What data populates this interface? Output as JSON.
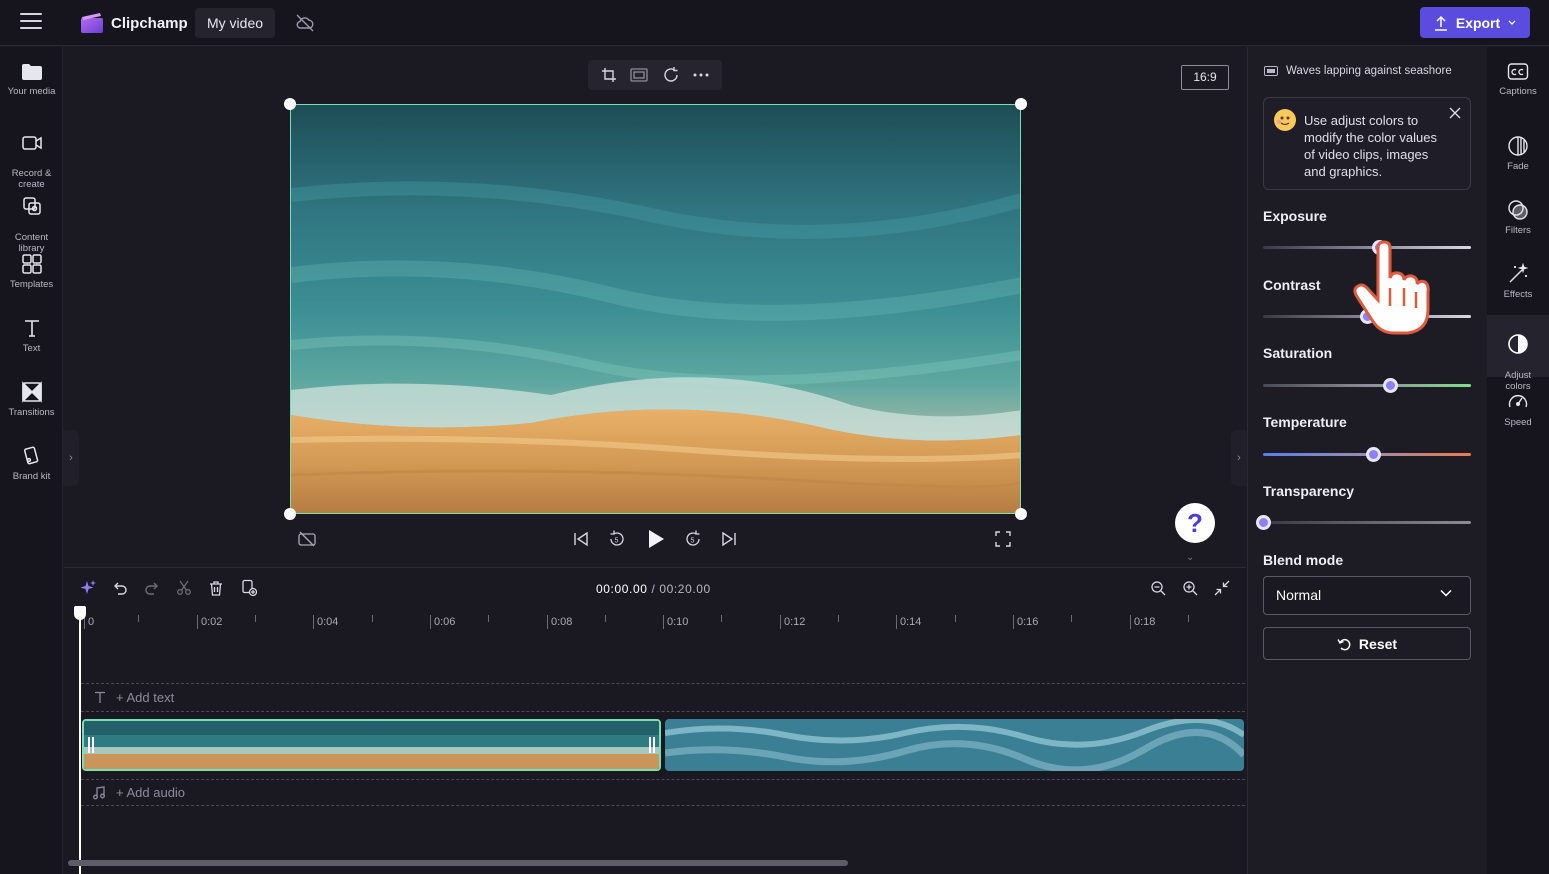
{
  "app": {
    "brand": "Clipchamp",
    "project_name": "My video",
    "export_label": "Export"
  },
  "left_rail": [
    {
      "id": "your-media",
      "label": "Your media"
    },
    {
      "id": "record-create",
      "label": "Record &\ncreate"
    },
    {
      "id": "content-library",
      "label": "Content\nlibrary"
    },
    {
      "id": "templates",
      "label": "Templates"
    },
    {
      "id": "text",
      "label": "Text"
    },
    {
      "id": "transitions",
      "label": "Transitions"
    },
    {
      "id": "brand-kit",
      "label": "Brand kit"
    }
  ],
  "preview": {
    "aspect_ratio": "16:9"
  },
  "timeline": {
    "current_time": "00:00.00",
    "duration": "/ 00:20.00",
    "ticks": [
      "0",
      "0:02",
      "0:04",
      "0:06",
      "0:08",
      "0:10",
      "0:12",
      "0:14",
      "0:16",
      "0:18"
    ],
    "add_text": "+ Add text",
    "add_audio": "+ Add audio"
  },
  "panel": {
    "clip_name": "Waves lapping against seashore",
    "tip": "Use adjust colors to modify the color values of video clips, images and graphics.",
    "exposure_label": "Exposure",
    "contrast_label": "Contrast",
    "saturation_label": "Saturation",
    "temperature_label": "Temperature",
    "transparency_label": "Transparency",
    "blend_mode_label": "Blend mode",
    "blend_mode_value": "Normal",
    "reset_label": "Reset",
    "slider_levels": {
      "exposure": 0.56,
      "contrast": 0.5,
      "saturation": 0.61,
      "temperature": 0.53,
      "transparency": 0.0
    }
  },
  "right_rail": [
    {
      "id": "captions",
      "label": "Captions"
    },
    {
      "id": "fade",
      "label": "Fade"
    },
    {
      "id": "filters",
      "label": "Filters"
    },
    {
      "id": "effects",
      "label": "Effects"
    },
    {
      "id": "adjust-colors",
      "label": "Adjust\ncolors"
    },
    {
      "id": "speed",
      "label": "Speed"
    }
  ],
  "colors": {
    "accent": "#5b4ce0",
    "selection": "#76e0b4",
    "knob": "#8f7ff5"
  }
}
